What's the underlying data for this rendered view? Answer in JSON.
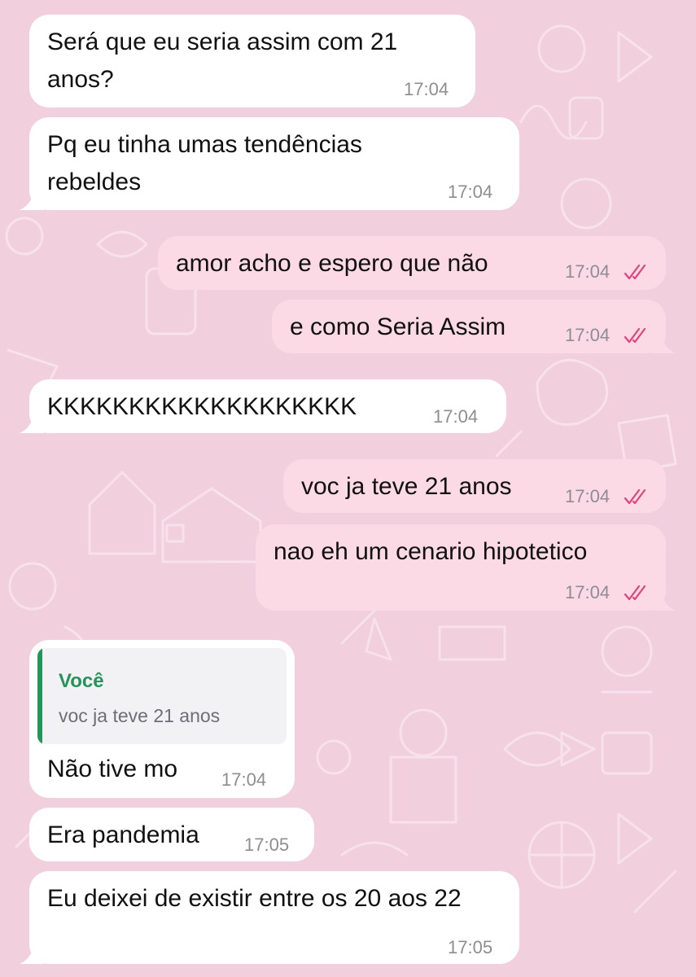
{
  "chat": {
    "messages": [
      {
        "text": "Será que eu seria assim com 21 anos?",
        "time": "17:04"
      },
      {
        "text": "Pq eu tinha umas tendências rebeldes",
        "time": "17:04"
      },
      {
        "text": "amor acho e espero que não",
        "time": "17:04"
      },
      {
        "text": "e como Seria Assim",
        "time": "17:04"
      },
      {
        "text": "KKKKKKKKKKKKKKKKKKK",
        "time": "17:04"
      },
      {
        "text": "voc ja teve 21 anos",
        "time": "17:04"
      },
      {
        "text": "nao eh um cenario hipotetico",
        "time": "17:04"
      },
      {
        "text": "Não tive mo",
        "time": "17:04",
        "quote": {
          "author": "Você",
          "text": "voc ja teve 21 anos"
        }
      },
      {
        "text": "Era pandemia",
        "time": "17:05"
      },
      {
        "text": "Eu deixei de existir entre os 20 aos 22",
        "time": "17:05"
      }
    ]
  },
  "colors": {
    "wallpaper": "#f1cfdc",
    "incoming_bubble": "#ffffff",
    "outgoing_bubble": "#fbd9e5",
    "read_ticks": "#e0447a",
    "quote_accent": "#25935a"
  },
  "icons": {
    "read_receipt": "double-check-icon"
  }
}
